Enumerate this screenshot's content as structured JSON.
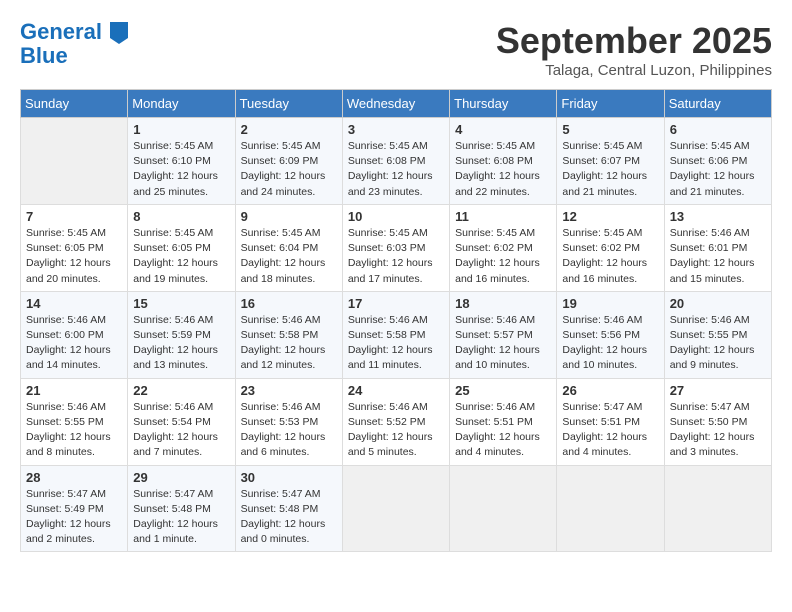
{
  "header": {
    "logo_line1": "General",
    "logo_line2": "Blue",
    "month": "September 2025",
    "location": "Talaga, Central Luzon, Philippines"
  },
  "weekdays": [
    "Sunday",
    "Monday",
    "Tuesday",
    "Wednesday",
    "Thursday",
    "Friday",
    "Saturday"
  ],
  "weeks": [
    [
      {
        "day": "",
        "info": ""
      },
      {
        "day": "1",
        "info": "Sunrise: 5:45 AM\nSunset: 6:10 PM\nDaylight: 12 hours\nand 25 minutes."
      },
      {
        "day": "2",
        "info": "Sunrise: 5:45 AM\nSunset: 6:09 PM\nDaylight: 12 hours\nand 24 minutes."
      },
      {
        "day": "3",
        "info": "Sunrise: 5:45 AM\nSunset: 6:08 PM\nDaylight: 12 hours\nand 23 minutes."
      },
      {
        "day": "4",
        "info": "Sunrise: 5:45 AM\nSunset: 6:08 PM\nDaylight: 12 hours\nand 22 minutes."
      },
      {
        "day": "5",
        "info": "Sunrise: 5:45 AM\nSunset: 6:07 PM\nDaylight: 12 hours\nand 21 minutes."
      },
      {
        "day": "6",
        "info": "Sunrise: 5:45 AM\nSunset: 6:06 PM\nDaylight: 12 hours\nand 21 minutes."
      }
    ],
    [
      {
        "day": "7",
        "info": "Sunrise: 5:45 AM\nSunset: 6:05 PM\nDaylight: 12 hours\nand 20 minutes."
      },
      {
        "day": "8",
        "info": "Sunrise: 5:45 AM\nSunset: 6:05 PM\nDaylight: 12 hours\nand 19 minutes."
      },
      {
        "day": "9",
        "info": "Sunrise: 5:45 AM\nSunset: 6:04 PM\nDaylight: 12 hours\nand 18 minutes."
      },
      {
        "day": "10",
        "info": "Sunrise: 5:45 AM\nSunset: 6:03 PM\nDaylight: 12 hours\nand 17 minutes."
      },
      {
        "day": "11",
        "info": "Sunrise: 5:45 AM\nSunset: 6:02 PM\nDaylight: 12 hours\nand 16 minutes."
      },
      {
        "day": "12",
        "info": "Sunrise: 5:45 AM\nSunset: 6:02 PM\nDaylight: 12 hours\nand 16 minutes."
      },
      {
        "day": "13",
        "info": "Sunrise: 5:46 AM\nSunset: 6:01 PM\nDaylight: 12 hours\nand 15 minutes."
      }
    ],
    [
      {
        "day": "14",
        "info": "Sunrise: 5:46 AM\nSunset: 6:00 PM\nDaylight: 12 hours\nand 14 minutes."
      },
      {
        "day": "15",
        "info": "Sunrise: 5:46 AM\nSunset: 5:59 PM\nDaylight: 12 hours\nand 13 minutes."
      },
      {
        "day": "16",
        "info": "Sunrise: 5:46 AM\nSunset: 5:58 PM\nDaylight: 12 hours\nand 12 minutes."
      },
      {
        "day": "17",
        "info": "Sunrise: 5:46 AM\nSunset: 5:58 PM\nDaylight: 12 hours\nand 11 minutes."
      },
      {
        "day": "18",
        "info": "Sunrise: 5:46 AM\nSunset: 5:57 PM\nDaylight: 12 hours\nand 10 minutes."
      },
      {
        "day": "19",
        "info": "Sunrise: 5:46 AM\nSunset: 5:56 PM\nDaylight: 12 hours\nand 10 minutes."
      },
      {
        "day": "20",
        "info": "Sunrise: 5:46 AM\nSunset: 5:55 PM\nDaylight: 12 hours\nand 9 minutes."
      }
    ],
    [
      {
        "day": "21",
        "info": "Sunrise: 5:46 AM\nSunset: 5:55 PM\nDaylight: 12 hours\nand 8 minutes."
      },
      {
        "day": "22",
        "info": "Sunrise: 5:46 AM\nSunset: 5:54 PM\nDaylight: 12 hours\nand 7 minutes."
      },
      {
        "day": "23",
        "info": "Sunrise: 5:46 AM\nSunset: 5:53 PM\nDaylight: 12 hours\nand 6 minutes."
      },
      {
        "day": "24",
        "info": "Sunrise: 5:46 AM\nSunset: 5:52 PM\nDaylight: 12 hours\nand 5 minutes."
      },
      {
        "day": "25",
        "info": "Sunrise: 5:46 AM\nSunset: 5:51 PM\nDaylight: 12 hours\nand 4 minutes."
      },
      {
        "day": "26",
        "info": "Sunrise: 5:47 AM\nSunset: 5:51 PM\nDaylight: 12 hours\nand 4 minutes."
      },
      {
        "day": "27",
        "info": "Sunrise: 5:47 AM\nSunset: 5:50 PM\nDaylight: 12 hours\nand 3 minutes."
      }
    ],
    [
      {
        "day": "28",
        "info": "Sunrise: 5:47 AM\nSunset: 5:49 PM\nDaylight: 12 hours\nand 2 minutes."
      },
      {
        "day": "29",
        "info": "Sunrise: 5:47 AM\nSunset: 5:48 PM\nDaylight: 12 hours\nand 1 minute."
      },
      {
        "day": "30",
        "info": "Sunrise: 5:47 AM\nSunset: 5:48 PM\nDaylight: 12 hours\nand 0 minutes."
      },
      {
        "day": "",
        "info": ""
      },
      {
        "day": "",
        "info": ""
      },
      {
        "day": "",
        "info": ""
      },
      {
        "day": "",
        "info": ""
      }
    ]
  ]
}
